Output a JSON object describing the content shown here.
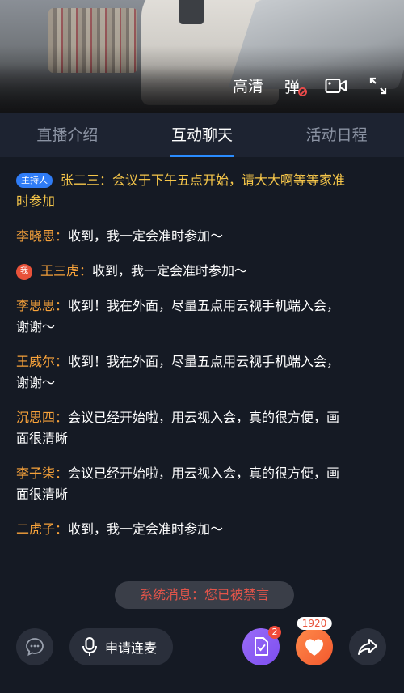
{
  "video": {
    "quality_label": "高清",
    "danmu_label": "弹"
  },
  "tabs": [
    {
      "label": "直播介绍",
      "active": false
    },
    {
      "label": "互动聊天",
      "active": true
    },
    {
      "label": "活动日程",
      "active": false
    }
  ],
  "chat": {
    "host_badge": "主持人",
    "me_badge": "我",
    "messages": [
      {
        "name": "张二三：",
        "text": "会议于下午五点开始，请大大啊等等家准时参加"
      },
      {
        "name": "李晓思：",
        "text": "收到，我一定会准时参加～"
      },
      {
        "name": "王三虎：",
        "text": "收到，我一定会准时参加～"
      },
      {
        "name": "李思思：",
        "text": "收到！我在外面，尽量五点用云视手机端入会，谢谢～"
      },
      {
        "name": "王威尔：",
        "text": "收到！我在外面，尽量五点用云视手机端入会，谢谢～"
      },
      {
        "name": "沉思四：",
        "text": "会议已经开始啦，用云视入会，真的很方便，画面很清晰"
      },
      {
        "name": "李子柒：",
        "text": "会议已经开始啦，用云视入会，真的很方便，画面很清晰"
      },
      {
        "name": "二虎子：",
        "text": "收到，我一定会准时参加～"
      }
    ]
  },
  "system_message": "系统消息：您已被禁言",
  "bottom": {
    "apply_label": "申请连麦",
    "doc_count": "2",
    "like_count": "1920"
  },
  "colors": {
    "background": "#151a24",
    "tab_bar": "#1d2331",
    "accent_blue": "#2a8cff",
    "name_orange": "#f7a23a",
    "host_yellow": "#f7c74a",
    "system_red": "#e0544a"
  }
}
